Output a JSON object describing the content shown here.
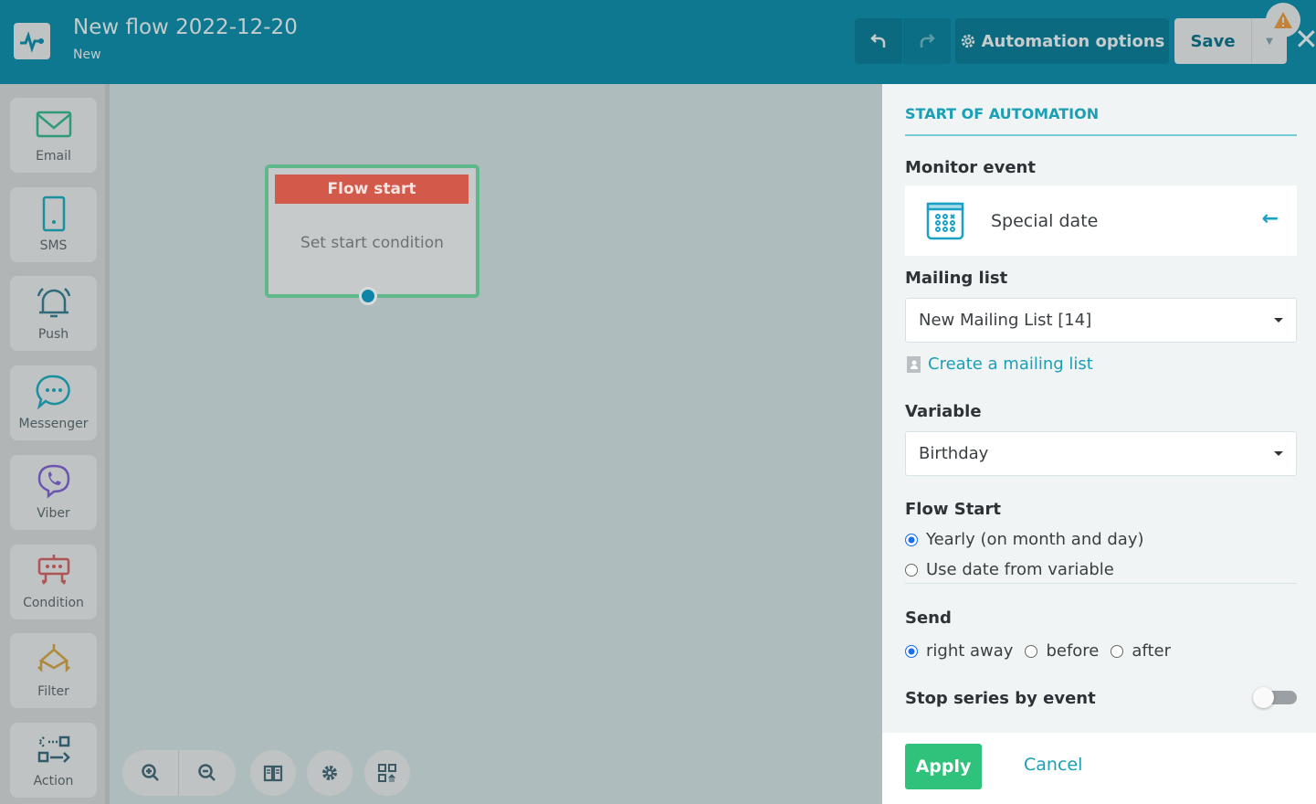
{
  "header": {
    "title": "New flow 2022-12-20",
    "subtitle": "New",
    "automation_options": "Automation options",
    "save": "Save"
  },
  "sidebar": {
    "items": [
      {
        "label": "Email",
        "color": "#2f9a7b"
      },
      {
        "label": "SMS",
        "color": "#1a8fa0"
      },
      {
        "label": "Push",
        "color": "#2f6b7a"
      },
      {
        "label": "Messenger",
        "color": "#1a8fa0"
      },
      {
        "label": "Viber",
        "color": "#6b55b0"
      },
      {
        "label": "Condition",
        "color": "#b05555"
      },
      {
        "label": "Filter",
        "color": "#b08a3a"
      },
      {
        "label": "Action",
        "color": "#2f5b6a"
      }
    ]
  },
  "node": {
    "title": "Flow start",
    "body": "Set start condition"
  },
  "panel": {
    "section_title": "START OF AUTOMATION",
    "monitor_event_label": "Monitor event",
    "event_name": "Special date",
    "mailing_list_label": "Mailing list",
    "mailing_list_value": "New Mailing List [14]",
    "create_mailing_list": "Create a mailing list",
    "variable_label": "Variable",
    "variable_value": "Birthday",
    "flow_start_label": "Flow Start",
    "flow_start_options": [
      "Yearly (on month and day)",
      "Use date from variable"
    ],
    "send_label": "Send",
    "send_options": [
      "right away",
      "before",
      "after"
    ],
    "stop_series_label": "Stop series by event",
    "stop_series_enabled": false,
    "apply": "Apply",
    "cancel": "Cancel"
  }
}
